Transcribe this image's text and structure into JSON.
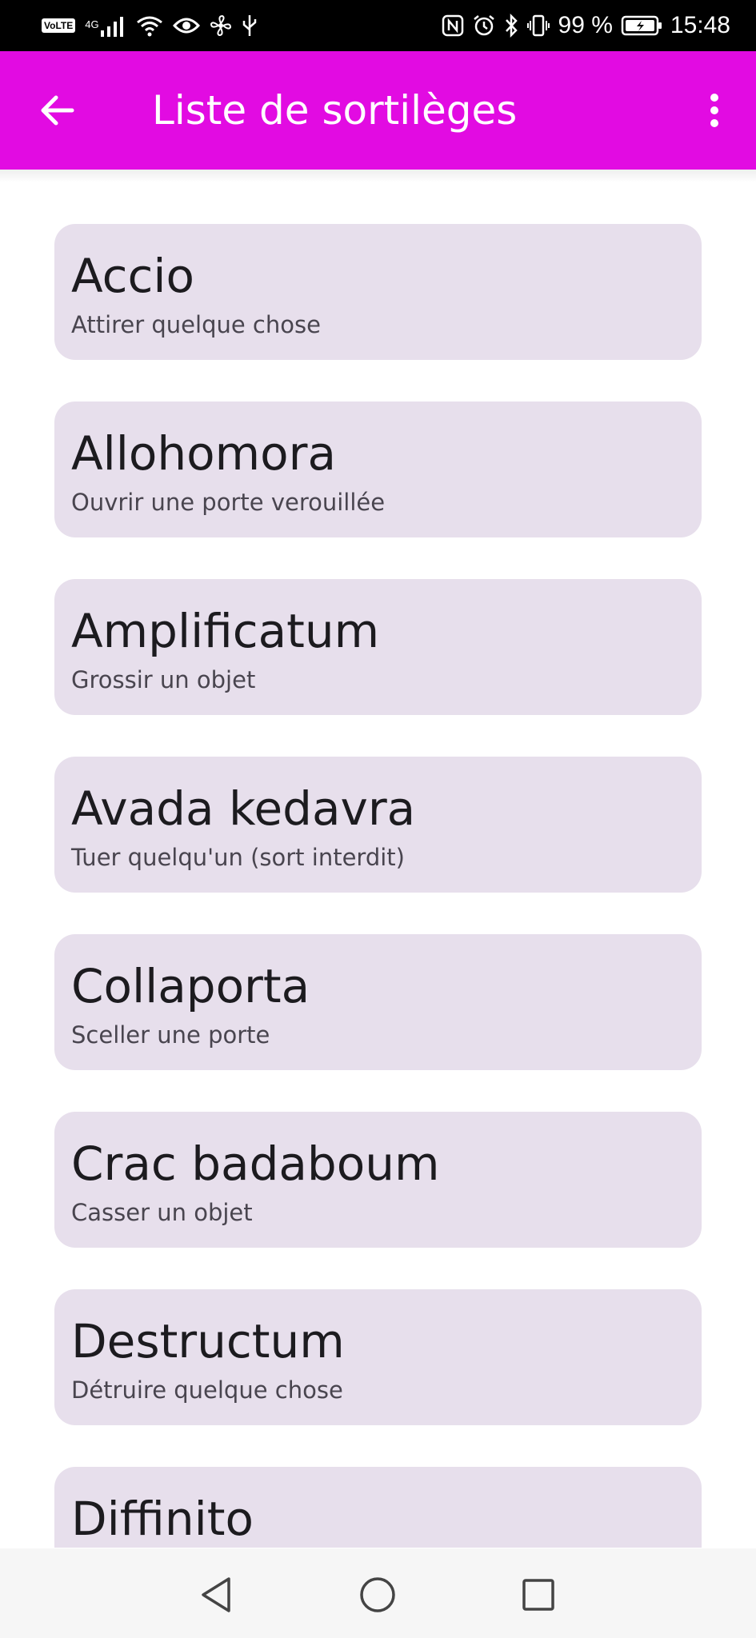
{
  "status_bar": {
    "volte": "VoLTE",
    "network": "4G",
    "battery": "99 %",
    "time": "15:48",
    "icons": [
      "volte-icon",
      "signal-icon",
      "wifi-icon",
      "eye-icon",
      "fan-icon",
      "usb-icon",
      "nfc-icon",
      "alarm-icon",
      "bluetooth-icon",
      "vibrate-icon",
      "battery-icon"
    ]
  },
  "app_bar": {
    "title": "Liste de sortilèges",
    "background": "#e20be2",
    "back_icon": "arrow-back-icon",
    "menu_icon": "more-vert-icon"
  },
  "spells": [
    {
      "name": "Accio",
      "description": "Attirer quelque chose"
    },
    {
      "name": "Allohomora",
      "description": "Ouvrir une porte verouillée"
    },
    {
      "name": "Amplificatum",
      "description": "Grossir un objet"
    },
    {
      "name": "Avada kedavra",
      "description": "Tuer quelqu'un (sort interdit)"
    },
    {
      "name": "Collaporta",
      "description": "Sceller une porte"
    },
    {
      "name": "Crac badaboum",
      "description": "Casser un objet"
    },
    {
      "name": "Destructum",
      "description": "Détruire quelque chose"
    },
    {
      "name": "Diffinito",
      "description": ""
    }
  ],
  "card_color": "#e7dfec",
  "nav_bar": {
    "icons": [
      "back-triangle-icon",
      "home-circle-icon",
      "recents-square-icon"
    ]
  }
}
